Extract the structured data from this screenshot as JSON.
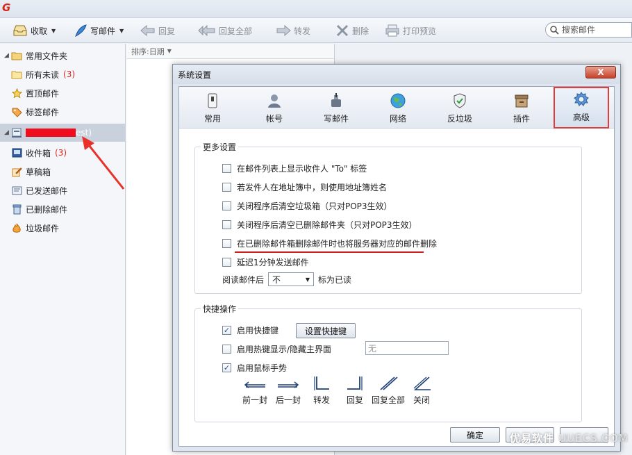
{
  "app": {
    "logo_glyph": "G"
  },
  "toolbar": {
    "receive": "收取",
    "compose": "写邮件",
    "reply": "回复",
    "reply_all": "回复全部",
    "forward": "转发",
    "delete": "删除",
    "print_preview": "打印预览",
    "search_placeholder": "搜索邮件"
  },
  "sidebar": {
    "common_folder": "常用文件夹",
    "all_unread": "所有未读",
    "all_unread_count": "(3)",
    "pinned": "置顶邮件",
    "tagged": "标签邮件",
    "account_suffix": "est)",
    "inbox": "收件箱",
    "inbox_count": "(3)",
    "drafts": "草稿箱",
    "sent": "已发送邮件",
    "deleted": "已删除邮件",
    "junk": "垃圾邮件"
  },
  "mail_list": {
    "sort_label": "排序:日期"
  },
  "dialog": {
    "title": "系统设置",
    "close_glyph": "X",
    "tabs": [
      "常用",
      "帐号",
      "写邮件",
      "网络",
      "反垃圾",
      "插件",
      "高级"
    ],
    "more_settings": {
      "legend": "更多设置",
      "options": [
        "在邮件列表上显示收件人 \"To\" 标签",
        "若发件人在地址簿中，则使用地址簿姓名",
        "关闭程序后清空垃圾箱（只对POP3生效）",
        "关闭程序后清空已删除邮件夹（只对POP3生效）",
        "在已删除邮件箱删除邮件时也将服务器对应的邮件删除",
        "延迟1分钟发送邮件"
      ],
      "read_after_label": "阅读邮件后",
      "read_after_value": "不",
      "mark_read_label": "标为已读"
    },
    "shortcuts": {
      "legend": "快捷操作",
      "enable_hotkeys": "启用快捷键",
      "set_hotkeys_button": "设置快捷键",
      "enable_toggle_hotkey": "启用热键显示/隐藏主界面",
      "hotkey_value": "无",
      "enable_gestures": "启用鼠标手势",
      "gestures": [
        "前一封",
        "后一封",
        "转发",
        "回复",
        "回复全部",
        "关闭"
      ]
    },
    "ok_button": "确定"
  },
  "watermark": {
    "brand": "优易软件",
    "domain": "UUECS.COM"
  },
  "colors": {
    "accent_red": "#d9261c",
    "highlight_red": "#e53a3a",
    "count_red": "#d9261c"
  }
}
